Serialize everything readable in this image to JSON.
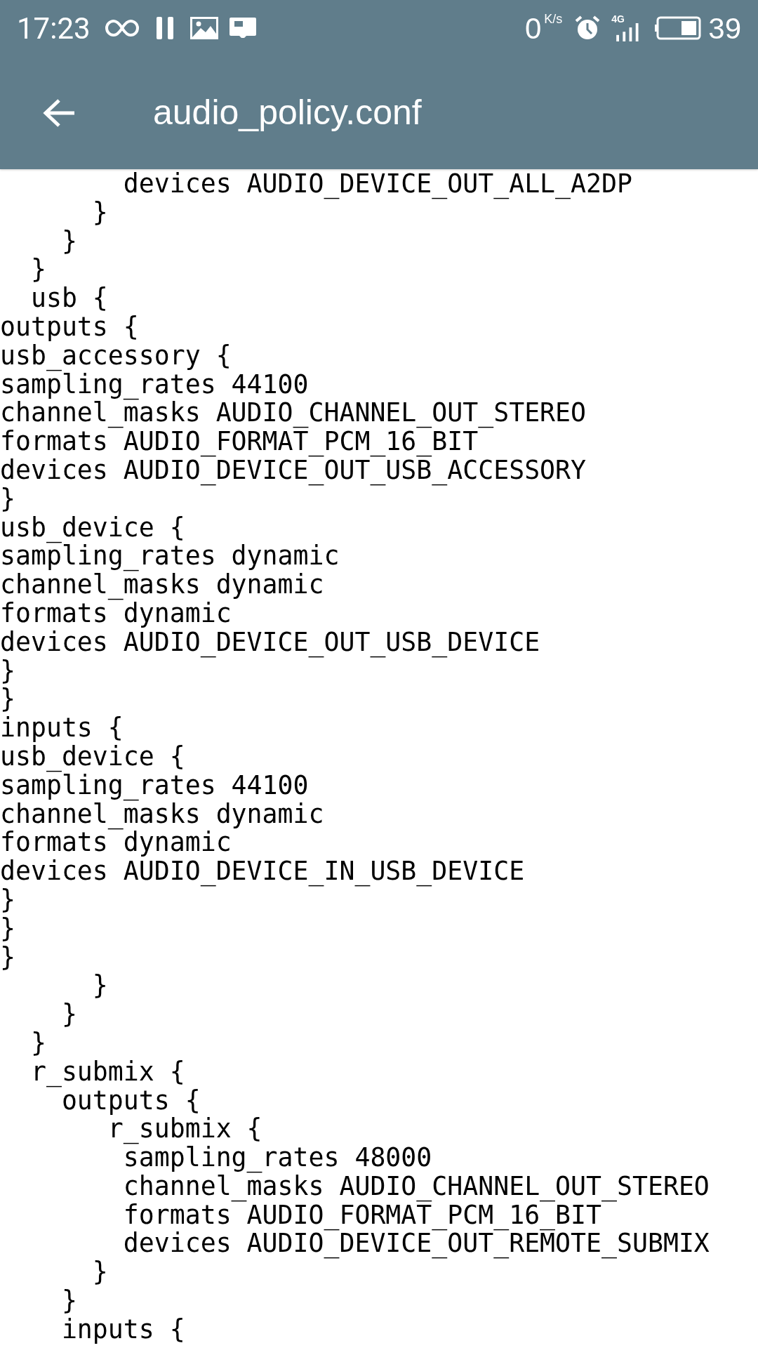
{
  "status_bar": {
    "time": "17:23",
    "speed": "0",
    "speed_unit": "K/s",
    "network": "4G",
    "battery": "39"
  },
  "toolbar": {
    "title": "audio_policy.conf"
  },
  "file_lines": [
    "        devices AUDIO_DEVICE_OUT_ALL_A2DP",
    "      }",
    "    }",
    "  }",
    "  usb {",
    "outputs {",
    "usb_accessory {",
    "sampling_rates 44100",
    "channel_masks AUDIO_CHANNEL_OUT_STEREO",
    "formats AUDIO_FORMAT_PCM_16_BIT",
    "devices AUDIO_DEVICE_OUT_USB_ACCESSORY",
    "}",
    "usb_device {",
    "sampling_rates dynamic",
    "channel_masks dynamic",
    "formats dynamic",
    "devices AUDIO_DEVICE_OUT_USB_DEVICE",
    "}",
    "}",
    "inputs {",
    "usb_device {",
    "sampling_rates 44100",
    "channel_masks dynamic",
    "formats dynamic",
    "devices AUDIO_DEVICE_IN_USB_DEVICE",
    "}",
    "}",
    "}",
    "      }",
    "    }",
    "  }",
    "  r_submix {",
    "    outputs {",
    "       r_submix {",
    "        sampling_rates 48000",
    "        channel_masks AUDIO_CHANNEL_OUT_STEREO",
    "        formats AUDIO_FORMAT_PCM_16_BIT",
    "        devices AUDIO_DEVICE_OUT_REMOTE_SUBMIX",
    "      }",
    "    }",
    "    inputs {"
  ]
}
